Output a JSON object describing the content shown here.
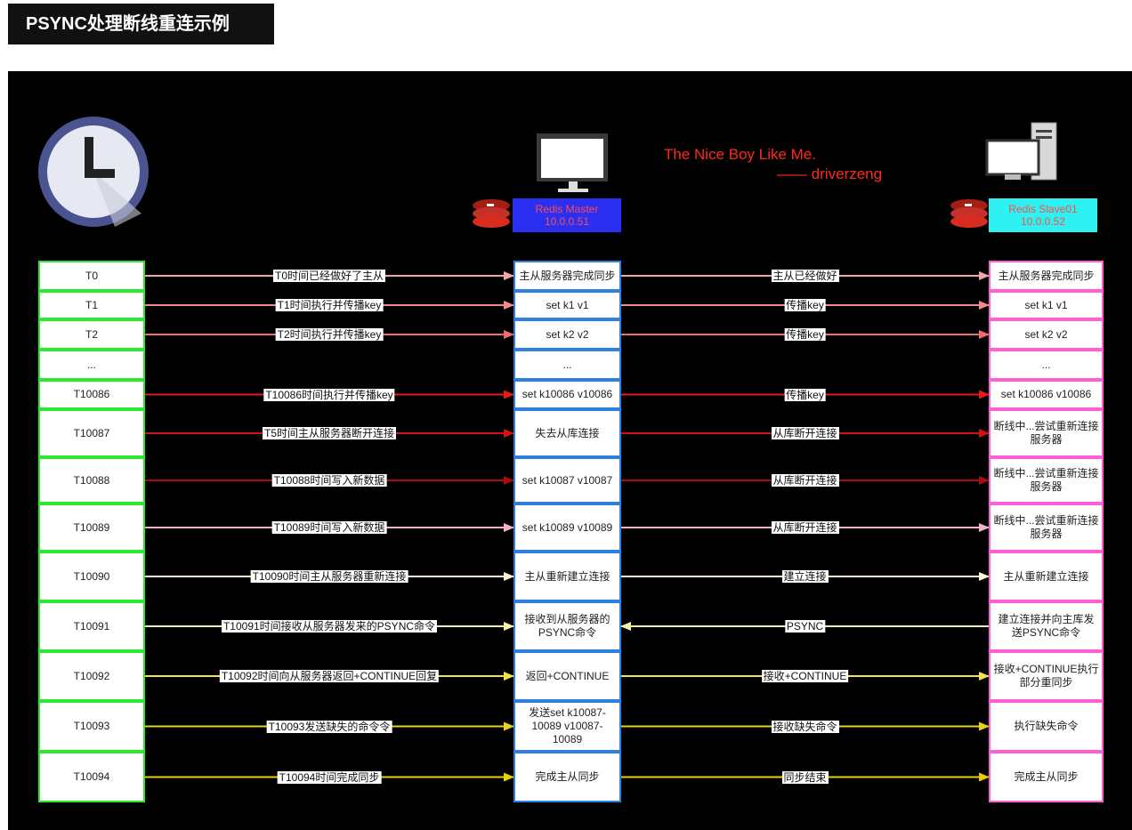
{
  "title": "PSYNC处理断线重连示例",
  "credit": {
    "line1": "The Nice Boy Like Me.",
    "line2": "—— driverzeng"
  },
  "master": {
    "name": "Redis Master",
    "ip": "10.0.0.51",
    "color": "#2b2ff2",
    "text_color": "#ff4b4b"
  },
  "slave": {
    "name": "Redis Slave01",
    "ip": "10.0.0.52",
    "color": "#2ef2f2",
    "text_color": "#ff4b4b"
  },
  "icons": {
    "clock": "clock-icon",
    "master_monitor": "monitor-icon",
    "slave_computer": "desktop-computer-icon",
    "redis": "redis-logo-icon"
  },
  "rows": [
    {
      "time": "T0",
      "left_label": "T0时间已经做好了主从",
      "master": "主从服务器完成同步",
      "right_label": "主从已经做好",
      "slave": "主从服务器完成同步",
      "direction": "right",
      "arrow_color": "#f4a6a6"
    },
    {
      "time": "T1",
      "left_label": "T1时间执行并传播key",
      "master": "set k1 v1",
      "right_label": "传播key",
      "slave": "set k1 v1",
      "direction": "right",
      "arrow_color": "#f28a8a"
    },
    {
      "time": "T2",
      "left_label": "T2时间执行并传播key",
      "master": "set k2 v2",
      "right_label": "传播key",
      "slave": "set k2 v2",
      "direction": "right",
      "arrow_color": "#ef6d6d"
    },
    {
      "time": "...",
      "left_label": "",
      "master": "...",
      "right_label": "",
      "slave": "...",
      "direction": "none",
      "arrow_color": "#ffffff"
    },
    {
      "time": "T10086",
      "left_label": "T10086时间执行并传播key",
      "master": "set k10086 v10086",
      "right_label": "传播key",
      "slave": "set k10086 v10086",
      "direction": "right",
      "arrow_color": "#e81b1b"
    },
    {
      "time": "T10087",
      "left_label": "T5时间主从服务器断开连接",
      "master": "失去从库连接",
      "right_label": "从库断开连接",
      "slave": "断线中...尝试重新连接服务器",
      "direction": "right",
      "arrow_color": "#d41212"
    },
    {
      "time": "T10088",
      "left_label": "T10088时间写入新数据",
      "master": "set k10087 v10087",
      "right_label": "从库断开连接",
      "slave": "断线中...尝试重新连接服务器",
      "direction": "right",
      "arrow_color": "#a80c0c"
    },
    {
      "time": "T10089",
      "left_label": "T10089时间写入新数据",
      "master": "set k10089 v10089",
      "right_label": "从库断开连接",
      "slave": "断线中...尝试重新连接服务器",
      "direction": "right",
      "arrow_color": "#f2b3c7"
    },
    {
      "time": "T10090",
      "left_label": "T10090时间主从服务器重新连接",
      "master": "主从重新建立连接",
      "right_label": "建立连接",
      "slave": "主从重新建立连接",
      "direction": "right",
      "arrow_color": "#fff3d6"
    },
    {
      "time": "T10091",
      "left_label": "T10091时间接收从服务器发来的PSYNC命令",
      "master": "接收到从服务器的PSYNC命令",
      "right_label": "PSYNC",
      "slave": "建立连接并向主库发送PSYNC命令",
      "direction": "left",
      "arrow_color": "#f5f0a8"
    },
    {
      "time": "T10092",
      "left_label": "T10092时间向从服务器返回+CONTINUE回复",
      "master": "返回+CONTINUE",
      "right_label": "接收+CONTINUE",
      "slave": "接收+CONTINUE执行部分重同步",
      "direction": "right",
      "arrow_color": "#f2e34a"
    },
    {
      "time": "T10093",
      "left_label": "T10093发送缺失的命令令",
      "master": "发送set k10087-10089 v10087-10089",
      "right_label": "接收缺失命令",
      "slave": "执行缺失命令",
      "direction": "right",
      "arrow_color": "#e6d21c"
    },
    {
      "time": "T10094",
      "left_label": "T10094时间完成同步",
      "master": "完成主从同步",
      "right_label": "同步结束",
      "slave": "完成主从同步",
      "direction": "right",
      "arrow_color": "#e8d000"
    }
  ]
}
